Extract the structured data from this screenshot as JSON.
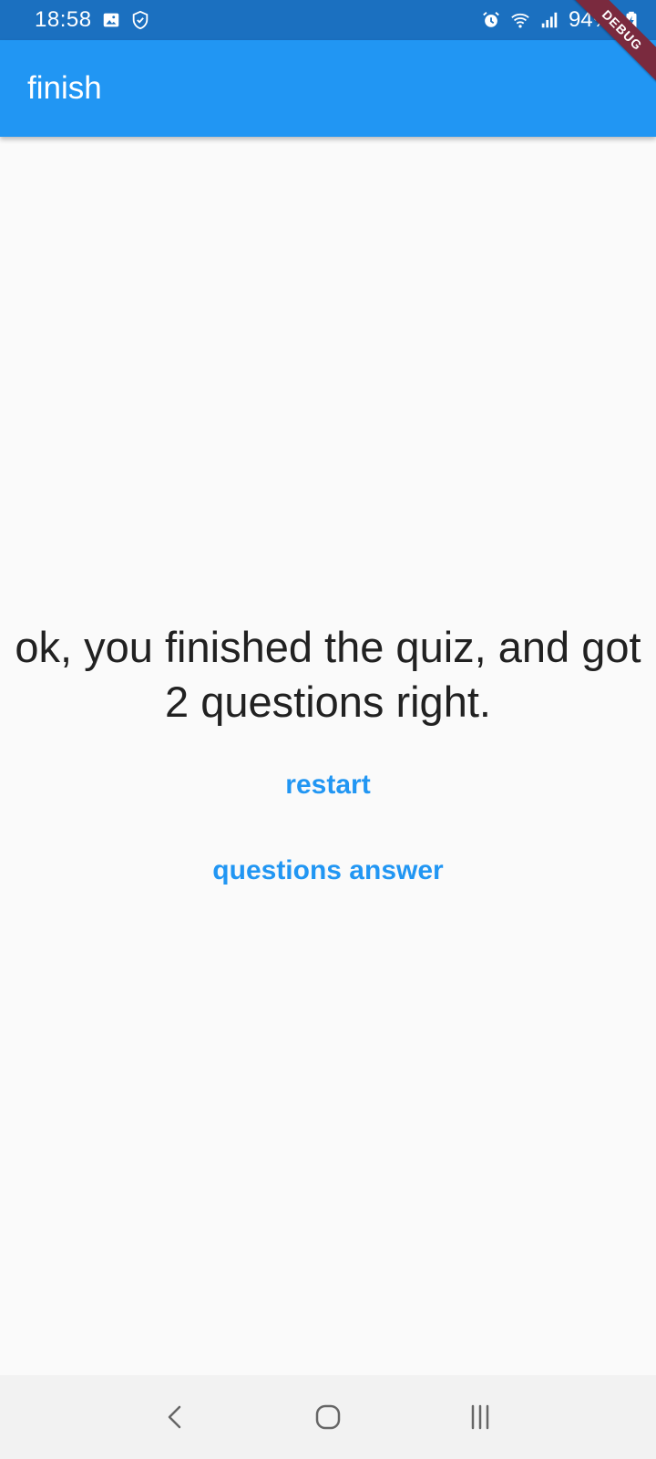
{
  "status_bar": {
    "time": "18:58",
    "battery": "94%",
    "icons": [
      "image-icon",
      "shield-icon",
      "alarm-icon",
      "wifi-icon",
      "signal-icon",
      "battery-charging-icon"
    ]
  },
  "app_bar": {
    "title": "finish",
    "color": "#2196f3"
  },
  "debug_banner": "DEBUG",
  "content": {
    "result_text": "ok, you finished the quiz, and got 2 questions right.",
    "restart_label": "restart",
    "answers_label": "questions answer",
    "accent_color": "#2196f3"
  },
  "nav_bar": {
    "icons": [
      "back-icon",
      "home-icon",
      "recent-apps-icon"
    ]
  }
}
